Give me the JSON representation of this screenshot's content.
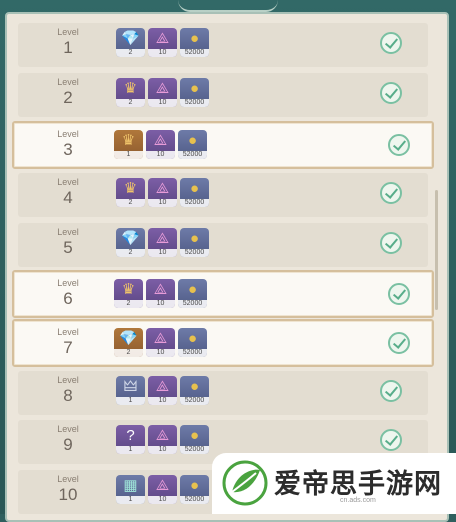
{
  "level_label": "Level",
  "rows": [
    {
      "level": "1",
      "highlight": false,
      "items": [
        {
          "icon": "gem-icon",
          "type": "blue",
          "qty": "2"
        },
        {
          "icon": "crystal-icon",
          "type": "purple",
          "qty": "10"
        },
        {
          "icon": "coin-icon",
          "type": "blue",
          "qty": "52000"
        }
      ],
      "claimed": true
    },
    {
      "level": "2",
      "highlight": false,
      "items": [
        {
          "icon": "crown-icon",
          "type": "purple",
          "qty": "2"
        },
        {
          "icon": "crystal-icon",
          "type": "purple",
          "qty": "10"
        },
        {
          "icon": "coin-icon",
          "type": "blue",
          "qty": "52000"
        }
      ],
      "claimed": true
    },
    {
      "level": "3",
      "highlight": true,
      "items": [
        {
          "icon": "crown-icon",
          "type": "gold",
          "qty": "1"
        },
        {
          "icon": "crystal-icon",
          "type": "purple",
          "qty": "10"
        },
        {
          "icon": "coin-icon",
          "type": "blue",
          "qty": "52000"
        }
      ],
      "claimed": true
    },
    {
      "level": "4",
      "highlight": false,
      "items": [
        {
          "icon": "crown-icon",
          "type": "purple",
          "qty": "2"
        },
        {
          "icon": "crystal-icon",
          "type": "purple",
          "qty": "10"
        },
        {
          "icon": "coin-icon",
          "type": "blue",
          "qty": "52000"
        }
      ],
      "claimed": true
    },
    {
      "level": "5",
      "highlight": false,
      "items": [
        {
          "icon": "gem-icon",
          "type": "blue",
          "qty": "2"
        },
        {
          "icon": "crystal-icon",
          "type": "purple",
          "qty": "10"
        },
        {
          "icon": "coin-icon",
          "type": "blue",
          "qty": "52000"
        }
      ],
      "claimed": true
    },
    {
      "level": "6",
      "highlight": true,
      "items": [
        {
          "icon": "crown-icon",
          "type": "purple",
          "qty": "2"
        },
        {
          "icon": "crystal-icon",
          "type": "purple",
          "qty": "10"
        },
        {
          "icon": "coin-icon",
          "type": "blue",
          "qty": "52000"
        }
      ],
      "claimed": true
    },
    {
      "level": "7",
      "highlight": true,
      "items": [
        {
          "icon": "gem-icon",
          "type": "gold",
          "qty": "2"
        },
        {
          "icon": "crystal-icon",
          "type": "purple",
          "qty": "10"
        },
        {
          "icon": "coin-icon",
          "type": "blue",
          "qty": "52000"
        }
      ],
      "claimed": true
    },
    {
      "level": "8",
      "highlight": false,
      "items": [
        {
          "icon": "pot-icon",
          "type": "blue",
          "qty": "1"
        },
        {
          "icon": "crystal-icon",
          "type": "purple",
          "qty": "10"
        },
        {
          "icon": "coin-icon",
          "type": "blue",
          "qty": "52000"
        }
      ],
      "claimed": true
    },
    {
      "level": "9",
      "highlight": false,
      "items": [
        {
          "icon": "question-icon",
          "type": "purple",
          "qty": "1"
        },
        {
          "icon": "crystal-icon",
          "type": "purple",
          "qty": "10"
        },
        {
          "icon": "coin-icon",
          "type": "blue",
          "qty": "52000"
        }
      ],
      "claimed": true
    },
    {
      "level": "10",
      "highlight": false,
      "items": [
        {
          "icon": "map-icon",
          "type": "blue",
          "qty": "1"
        },
        {
          "icon": "crystal-icon",
          "type": "purple",
          "qty": "10"
        },
        {
          "icon": "coin-icon",
          "type": "blue",
          "qty": "52000"
        }
      ],
      "claimed": false
    }
  ],
  "watermark": {
    "text": "爱帝思手游网",
    "url": "cn.ads.com",
    "logo_icon": "leaf-logo-icon"
  },
  "colors": {
    "check": "#58ad8a",
    "highlight_border": "#d5bf9c",
    "frame": "#2f5f5e"
  }
}
